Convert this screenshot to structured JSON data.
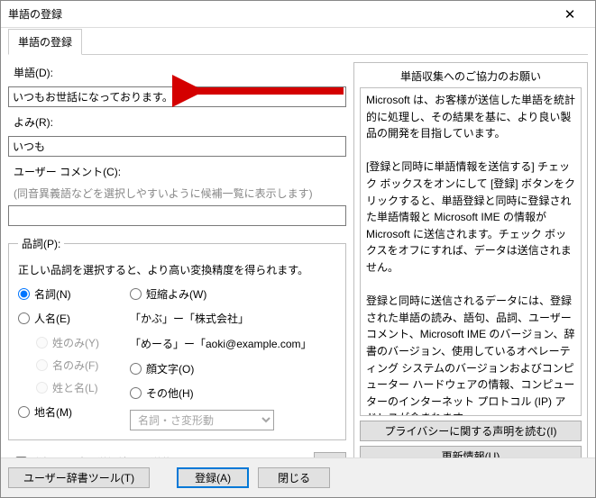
{
  "window": {
    "title": "単語の登録",
    "close": "✕"
  },
  "tab": {
    "label": "単語の登録"
  },
  "fields": {
    "word_label": "単語(D):",
    "word_value": "いつもお世話になっております。",
    "reading_label": "よみ(R):",
    "reading_value": "いつも",
    "comment_label": "ユーザー コメント(C):",
    "comment_hint": "(同音異義語などを選択しやすいように候補一覧に表示します)",
    "comment_value": ""
  },
  "pos": {
    "legend": "品詞(P):",
    "note": "正しい品詞を選択すると、より高い変換精度を得られます。",
    "noun": "名詞(N)",
    "person": "人名(E)",
    "surname_only": "姓のみ(Y)",
    "given_only": "名のみ(F)",
    "full_name": "姓と名(L)",
    "place": "地名(M)",
    "short_reading": "短縮よみ(W)",
    "example1": "「かぶ」ー「株式会社」",
    "example2": "「めーる」ー「aoki@example.com」",
    "emoticon": "顔文字(O)",
    "other": "その他(H)",
    "sub_select": "名詞・さ変形動"
  },
  "send": {
    "checkbox": "登録と同時に単語情報を送信する(S)",
    "collapse": "<<"
  },
  "right": {
    "title": "単語収集へのご協力のお願い",
    "body": "Microsoft は、お客様が送信した単語を統計的に処理し、その結果を基に、より良い製品の開発を目指しています。\n\n[登録と同時に単語情報を送信する] チェック ボックスをオンにして [登録] ボタンをクリックすると、単語登録と同時に登録された単語情報と Microsoft IME の情報が Microsoft に送信されます。チェック ボックスをオフにすれば、データは送信されません。\n\n登録と同時に送信されるデータには、登録された単語の読み、語句、品詞、ユーザー コメント、Microsoft IME のバージョン、辞書のバージョン、使用しているオペレーティング システムのバージョンおよびコンピューター ハードウェアの情報、コンピューターのインターネット プロトコル (IP) アドレスが含まれます。\n\nお客様特有の情報が収集されたデータに含まれることがあります。このような情報が存在する場合でも、Microsoft では、お客様を特定するために使用することはありません。",
    "privacy_btn": "プライバシーに関する声明を読む(I)",
    "update_btn": "更新情報(U)"
  },
  "footer": {
    "dict_tool": "ユーザー辞書ツール(T)",
    "register": "登録(A)",
    "close": "閉じる"
  }
}
